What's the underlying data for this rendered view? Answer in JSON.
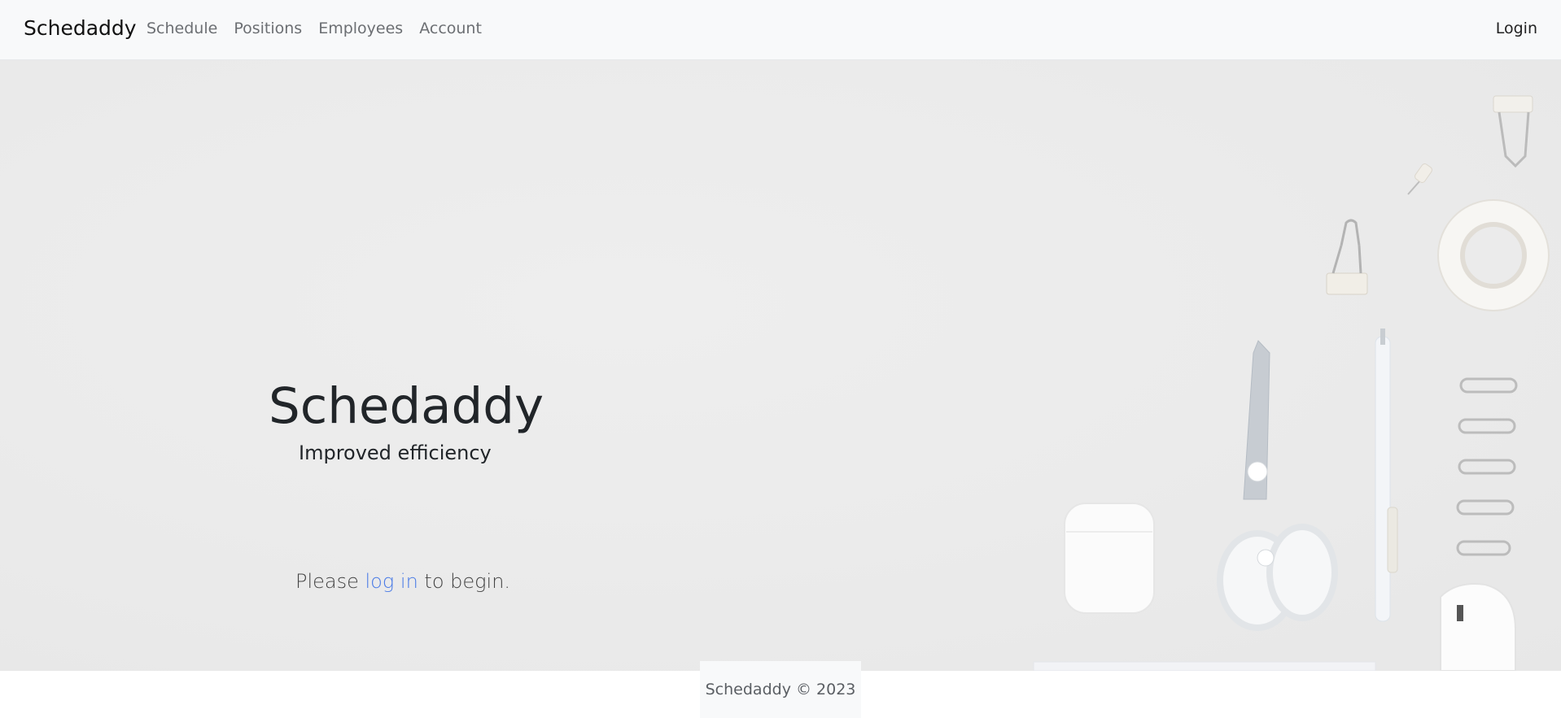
{
  "navbar": {
    "brand": "Schedaddy",
    "links": [
      {
        "label": "Schedule"
      },
      {
        "label": "Positions"
      },
      {
        "label": "Employees"
      },
      {
        "label": "Account"
      }
    ],
    "login_label": "Login"
  },
  "hero": {
    "title": "Schedaddy",
    "subtitle": "Improved efficiency",
    "cta_before": "Please ",
    "cta_link": "log in",
    "cta_after": " to begin."
  },
  "footer": {
    "text": "Schedaddy © 2023"
  },
  "colors": {
    "navbar_bg": "#f8f9fa",
    "link_accent": "#4a7be6",
    "hero_bg": "#ebebeb"
  }
}
